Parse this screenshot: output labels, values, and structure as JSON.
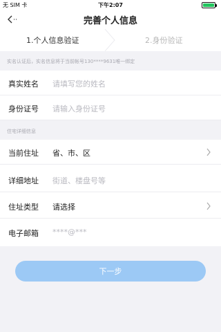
{
  "status_bar": {
    "carrier": "无 SIM 卡",
    "time": "下午2:07"
  },
  "nav": {
    "title": "完善个人信息"
  },
  "steps": {
    "step1": "1.个人信息验证",
    "step2": "2.身份验证"
  },
  "notice": "实名认证后，实名信息将于当前帐号130****9631唯一绑定",
  "identity": {
    "name_label": "真实姓名",
    "name_placeholder": "请填写您的姓名",
    "id_label": "身份证号",
    "id_placeholder": "请输入身份证号"
  },
  "section_title": "住宅详细信息",
  "address": {
    "current_label": "当前住址",
    "current_value": "省、市、区",
    "detail_label": "详细地址",
    "detail_placeholder": "街道、楼盘号等",
    "type_label": "住址类型",
    "type_value": "请选择",
    "email_label": "电子邮箱",
    "email_placeholder": "****@***"
  },
  "next_button": "下一步",
  "colors": {
    "accent": "#9cc9f5",
    "battery": "#22c55e",
    "page_bg": "#f2f2f6"
  }
}
